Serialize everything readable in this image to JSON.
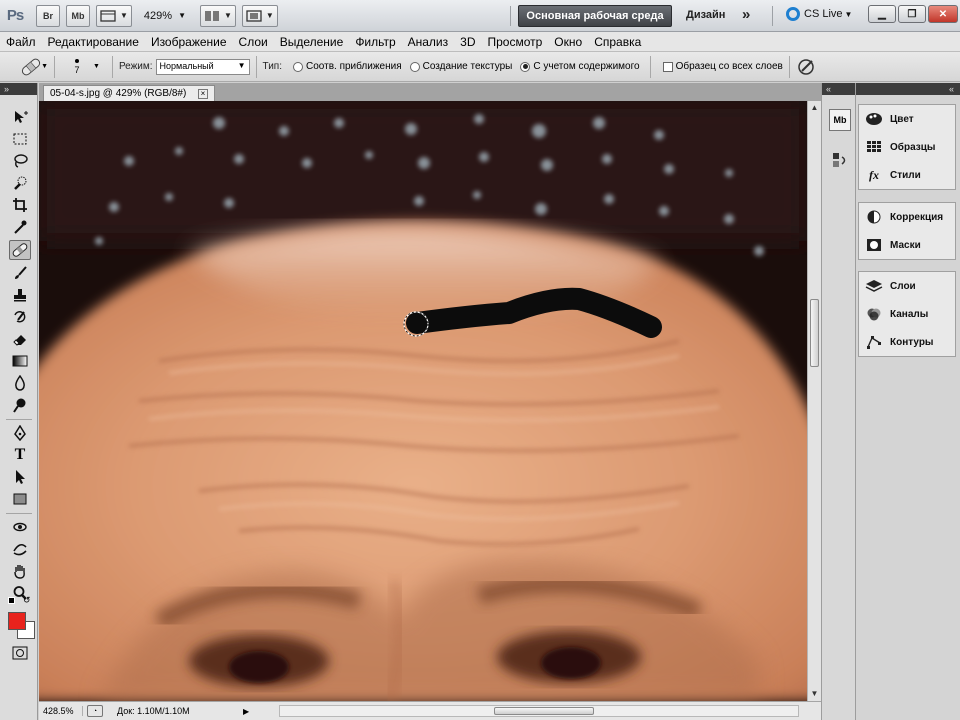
{
  "app": {
    "logo": "Ps",
    "bridge_label": "Br",
    "minibridge_label": "Mb",
    "zoom": "429%",
    "workspace_active": "Основная рабочая среда",
    "workspace_design": "Дизайн",
    "workspace_more": "»",
    "cs_live": "CS Live"
  },
  "menu": [
    "Файл",
    "Редактирование",
    "Изображение",
    "Слои",
    "Выделение",
    "Фильтр",
    "Анализ",
    "3D",
    "Просмотр",
    "Окно",
    "Справка"
  ],
  "options": {
    "brush_size": "7",
    "mode_label": "Режим:",
    "mode_value": "Нормальный",
    "type_label": "Тип:",
    "radio_proximity": "Соотв. приближения",
    "radio_texture": "Создание текстуры",
    "radio_content": "С учетом содержимого",
    "sample_all": "Образец со всех слоев",
    "selected_radio": "content"
  },
  "document": {
    "tab_title": "05-04-s.jpg @ 429% (RGB/8#)",
    "close": "×"
  },
  "status": {
    "zoom": "428.5%",
    "doc_size": "Док: 1.10M/1.10M"
  },
  "colors": {
    "foreground": "#e8231d",
    "background": "#ffffff",
    "accent": "#1e7fd0"
  },
  "panels": {
    "group1": [
      "Цвет",
      "Образцы",
      "Стили"
    ],
    "group2": [
      "Коррекция",
      "Маски"
    ],
    "group3": [
      "Слои",
      "Каналы",
      "Контуры"
    ]
  },
  "dock": {
    "minibridge": "Mb"
  }
}
